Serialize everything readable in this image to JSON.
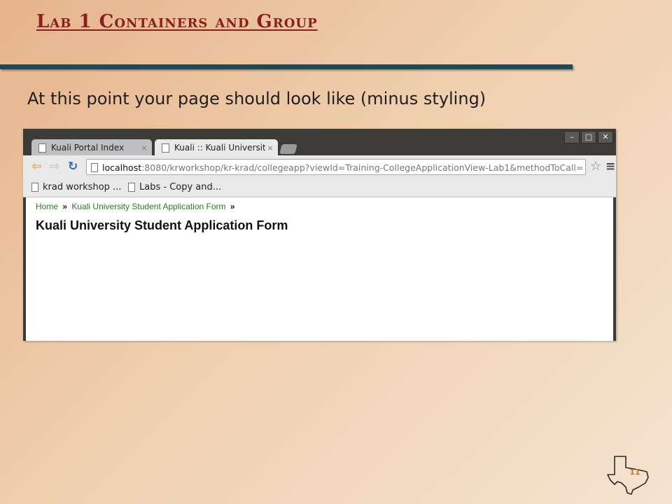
{
  "slide": {
    "title": "Lab 1 Containers and Group",
    "subtitle": "At this point your page should look like (minus styling)",
    "page_number": "11"
  },
  "browser": {
    "tabs": [
      {
        "label": "Kuali Portal Index",
        "active": false
      },
      {
        "label": "Kuali :: Kuali University Stu",
        "active": true
      }
    ],
    "window_buttons": [
      "–",
      "□",
      "✕"
    ],
    "tab_close": "×",
    "url": {
      "host": "localhost",
      "rest": ":8080/krworkshop/kr-krad/collegeapp?viewId=Training-CollegeApplicationView-Lab1&methodToCall="
    },
    "bookmarks": [
      {
        "label": "krad workshop ..."
      },
      {
        "label": "Labs - Copy and..."
      }
    ],
    "icons": {
      "back": "back-arrow-icon",
      "forward": "forward-arrow-icon",
      "reload": "reload-icon",
      "star": "bookmark-star-icon",
      "menu": "menu-icon"
    }
  },
  "page": {
    "breadcrumb": {
      "home": "Home",
      "separator": "»",
      "current": "Kuali University Student Application Form"
    },
    "heading": "Kuali University Student Application Form"
  },
  "colors": {
    "title": "#8b1e1e",
    "title_bar": "#1f4a55",
    "breadcrumb_link": "#2c7a1f"
  }
}
